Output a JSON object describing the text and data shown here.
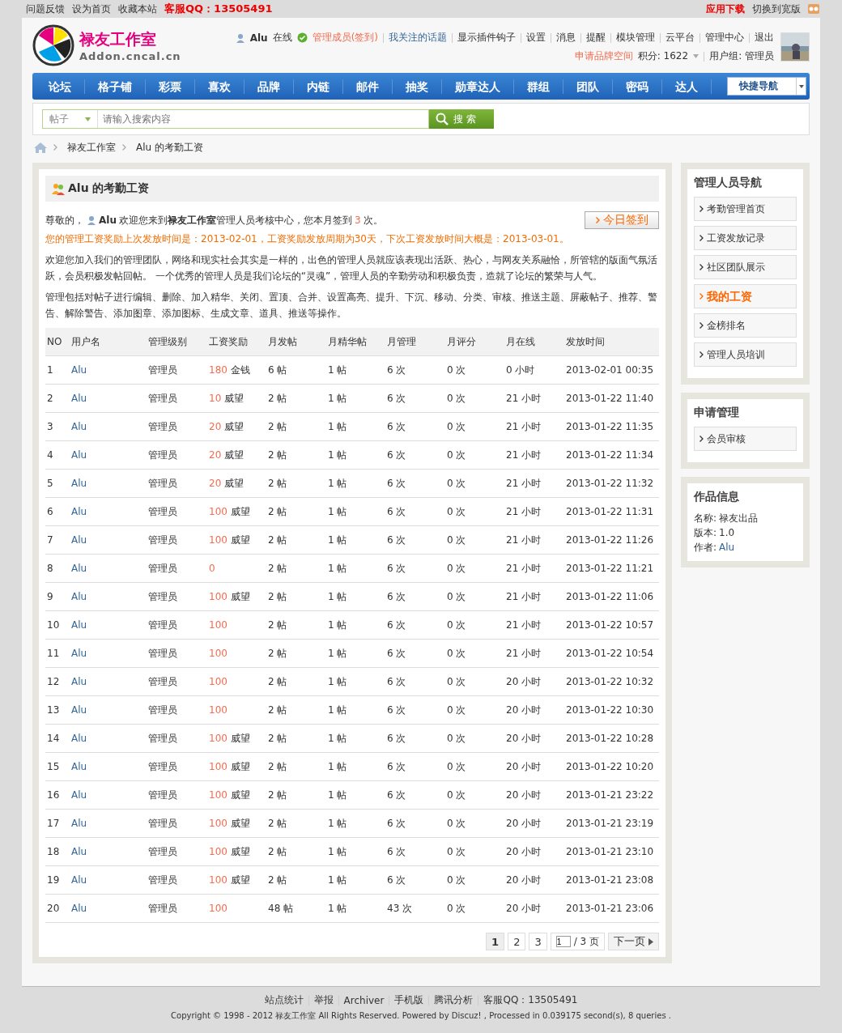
{
  "topbar": {
    "links": [
      "问题反馈",
      "设为首页",
      "收藏本站"
    ],
    "qq": "客服QQ：13505491",
    "app_download": "应用下载",
    "switch_wide": "切换到宽版"
  },
  "logo": {
    "title": "禄友工作室",
    "domain": "Addon.cncal.cn"
  },
  "user": {
    "name": "Alu",
    "status": "在线",
    "sign_link": "管理成员(签到)",
    "followed": "我关注的话题",
    "links": [
      "显示插件钩子",
      "设置",
      "消息",
      "提醒",
      "模块管理",
      "云平台",
      "管理中心",
      "退出"
    ],
    "brand_space": "申请品牌空间",
    "points": "积分: 1622",
    "user_group": "用户组: 管理员"
  },
  "nav": {
    "items": [
      "论坛",
      "格子铺",
      "彩票",
      "喜欢",
      "品牌",
      "内链",
      "邮件",
      "抽奖",
      "勋章达人",
      "群组",
      "团队",
      "密码",
      "达人"
    ],
    "quick_nav": "快捷导航"
  },
  "search": {
    "type": "帖子",
    "placeholder": "请输入搜索内容",
    "button": "搜 索"
  },
  "breadcrumb": [
    "禄友工作室",
    "Alu 的考勤工资"
  ],
  "main": {
    "title": "Alu 的考勤工资",
    "greeting": {
      "prefix": "尊敬的，",
      "user": "Alu",
      "text": "欢迎您来到**禄友工作室**管理人员考核中心，您本月签到",
      "count": "3",
      "suffix": "次。"
    },
    "sign_button": "今日签到",
    "notice": "您的管理工资奖励上次发放时间是：2013-02-01，工资奖励发放周期为30天，下次工资发放时间大概是：2013-03-01。",
    "paragraphs": [
      "欢迎您加入我们的管理团队，网络和现实社会其实是一样的，出色的管理人员就应该表现出活跃、热心，与网友关系融恰，所管辖的版面气氛活跃，会员积极发帖回帖。 一个优秀的管理人员是我们论坛的“灵魂”，管理人员的辛勤劳动和积极负责，造就了论坛的繁荣与人气。",
      "管理包括对帖子进行编辑、删除、加入精华、关闭、置顶、合并、设置高亮、提升、下沉、移动、分类、审核、推送主题、屏蔽帖子、推荐、警告、解除警告、添加图章、添加图标、生成文章、道具、推送等操作。"
    ],
    "table": {
      "columns": [
        "NO",
        "用户名",
        "管理级别",
        "工资奖励",
        "月发帖",
        "月精华帖",
        "月管理",
        "月评分",
        "月在线",
        "发放时间"
      ],
      "rows": [
        {
          "no": "1",
          "user": "Alu",
          "level": "管理员",
          "reward": "180",
          "reward_unit": "金钱",
          "posts": "6 帖",
          "digest": "1 帖",
          "manage": "6 次",
          "rating": "0 次",
          "online": "0 小时",
          "time": "2013-02-01 00:35"
        },
        {
          "no": "2",
          "user": "Alu",
          "level": "管理员",
          "reward": "10",
          "reward_unit": "威望",
          "posts": "2 帖",
          "digest": "1 帖",
          "manage": "6 次",
          "rating": "0 次",
          "online": "21 小时",
          "time": "2013-01-22 11:40"
        },
        {
          "no": "3",
          "user": "Alu",
          "level": "管理员",
          "reward": "20",
          "reward_unit": "威望",
          "posts": "2 帖",
          "digest": "1 帖",
          "manage": "6 次",
          "rating": "0 次",
          "online": "21 小时",
          "time": "2013-01-22 11:35"
        },
        {
          "no": "4",
          "user": "Alu",
          "level": "管理员",
          "reward": "20",
          "reward_unit": "威望",
          "posts": "2 帖",
          "digest": "1 帖",
          "manage": "6 次",
          "rating": "0 次",
          "online": "21 小时",
          "time": "2013-01-22 11:34"
        },
        {
          "no": "5",
          "user": "Alu",
          "level": "管理员",
          "reward": "20",
          "reward_unit": "威望",
          "posts": "2 帖",
          "digest": "1 帖",
          "manage": "6 次",
          "rating": "0 次",
          "online": "21 小时",
          "time": "2013-01-22 11:32"
        },
        {
          "no": "6",
          "user": "Alu",
          "level": "管理员",
          "reward": "100",
          "reward_unit": "威望",
          "posts": "2 帖",
          "digest": "1 帖",
          "manage": "6 次",
          "rating": "0 次",
          "online": "21 小时",
          "time": "2013-01-22 11:31"
        },
        {
          "no": "7",
          "user": "Alu",
          "level": "管理员",
          "reward": "100",
          "reward_unit": "威望",
          "posts": "2 帖",
          "digest": "1 帖",
          "manage": "6 次",
          "rating": "0 次",
          "online": "21 小时",
          "time": "2013-01-22 11:26"
        },
        {
          "no": "8",
          "user": "Alu",
          "level": "管理员",
          "reward": "0",
          "posts": "2 帖",
          "digest": "1 帖",
          "manage": "6 次",
          "rating": "0 次",
          "online": "21 小时",
          "time": "2013-01-22 11:21"
        },
        {
          "no": "9",
          "user": "Alu",
          "level": "管理员",
          "reward": "100",
          "reward_unit": "威望",
          "posts": "2 帖",
          "digest": "1 帖",
          "manage": "6 次",
          "rating": "0 次",
          "online": "21 小时",
          "time": "2013-01-22 11:06"
        },
        {
          "no": "10",
          "user": "Alu",
          "level": "管理员",
          "reward": "100",
          "posts": "2 帖",
          "digest": "1 帖",
          "manage": "6 次",
          "rating": "0 次",
          "online": "21 小时",
          "time": "2013-01-22 10:57"
        },
        {
          "no": "11",
          "user": "Alu",
          "level": "管理员",
          "reward": "100",
          "posts": "2 帖",
          "digest": "1 帖",
          "manage": "6 次",
          "rating": "0 次",
          "online": "21 小时",
          "time": "2013-01-22 10:54"
        },
        {
          "no": "12",
          "user": "Alu",
          "level": "管理员",
          "reward": "100",
          "posts": "2 帖",
          "digest": "1 帖",
          "manage": "6 次",
          "rating": "0 次",
          "online": "20 小时",
          "time": "2013-01-22 10:32"
        },
        {
          "no": "13",
          "user": "Alu",
          "level": "管理员",
          "reward": "100",
          "posts": "2 帖",
          "digest": "1 帖",
          "manage": "6 次",
          "rating": "0 次",
          "online": "20 小时",
          "time": "2013-01-22 10:30"
        },
        {
          "no": "14",
          "user": "Alu",
          "level": "管理员",
          "reward": "100",
          "reward_unit": "威望",
          "posts": "2 帖",
          "digest": "1 帖",
          "manage": "6 次",
          "rating": "0 次",
          "online": "20 小时",
          "time": "2013-01-22 10:28"
        },
        {
          "no": "15",
          "user": "Alu",
          "level": "管理员",
          "reward": "100",
          "reward_unit": "威望",
          "posts": "2 帖",
          "digest": "1 帖",
          "manage": "6 次",
          "rating": "0 次",
          "online": "20 小时",
          "time": "2013-01-22 10:20"
        },
        {
          "no": "16",
          "user": "Alu",
          "level": "管理员",
          "reward": "100",
          "reward_unit": "威望",
          "posts": "2 帖",
          "digest": "1 帖",
          "manage": "6 次",
          "rating": "0 次",
          "online": "20 小时",
          "time": "2013-01-21 23:22"
        },
        {
          "no": "17",
          "user": "Alu",
          "level": "管理员",
          "reward": "100",
          "reward_unit": "威望",
          "posts": "2 帖",
          "digest": "1 帖",
          "manage": "6 次",
          "rating": "0 次",
          "online": "20 小时",
          "time": "2013-01-21 23:19"
        },
        {
          "no": "18",
          "user": "Alu",
          "level": "管理员",
          "reward": "100",
          "reward_unit": "威望",
          "posts": "2 帖",
          "digest": "1 帖",
          "manage": "6 次",
          "rating": "0 次",
          "online": "20 小时",
          "time": "2013-01-21 23:10"
        },
        {
          "no": "19",
          "user": "Alu",
          "level": "管理员",
          "reward": "100",
          "reward_unit": "威望",
          "posts": "2 帖",
          "digest": "1 帖",
          "manage": "6 次",
          "rating": "0 次",
          "online": "20 小时",
          "time": "2013-01-21 23:08"
        },
        {
          "no": "20",
          "user": "Alu",
          "level": "管理员",
          "reward": "100",
          "posts": "48 帖",
          "digest": "1 帖",
          "manage": "43 次",
          "rating": "0 次",
          "online": "20 小时",
          "time": "2013-01-21 23:06"
        }
      ]
    },
    "pagination": {
      "pages": [
        {
          "label": "1",
          "selected": true
        },
        {
          "label": "2",
          "selected": false
        },
        {
          "label": "3",
          "selected": false
        }
      ],
      "page_input": "1",
      "total": "/ 3 页",
      "next": "下一页"
    }
  },
  "sidebar": {
    "panels": [
      {
        "title": "管理人员导航",
        "items": [
          {
            "label": "考勤管理首页",
            "selected": false
          },
          {
            "label": "工资发放记录",
            "selected": false
          },
          {
            "label": "社区团队展示",
            "selected": false
          },
          {
            "label": "我的工资",
            "selected": true
          },
          {
            "label": "金榜排名",
            "selected": false
          },
          {
            "label": "管理人员培训",
            "selected": false
          }
        ]
      },
      {
        "title": "申请管理",
        "items": [
          {
            "label": "会员审核",
            "selected": false
          }
        ]
      }
    ],
    "info": {
      "title": "作品信息",
      "lines": [
        {
          "label": "名称:",
          "value": "禄友出品",
          "kind": "plain"
        },
        {
          "label": "版本:",
          "value": "1.0",
          "kind": "plain"
        },
        {
          "label": "作者:",
          "value": "Alu",
          "kind": "link"
        }
      ]
    }
  },
  "footer": {
    "links": [
      "站点统计",
      "举报",
      "Archiver",
      "手机版",
      "腾讯分析",
      "客服QQ：13505491"
    ],
    "copyright": "Copyright © 1998 - 2012 禄友工作室 All Rights Reserved. Powered by Discuz! , Processed in 0.039175 second(s), 8 queries ."
  }
}
